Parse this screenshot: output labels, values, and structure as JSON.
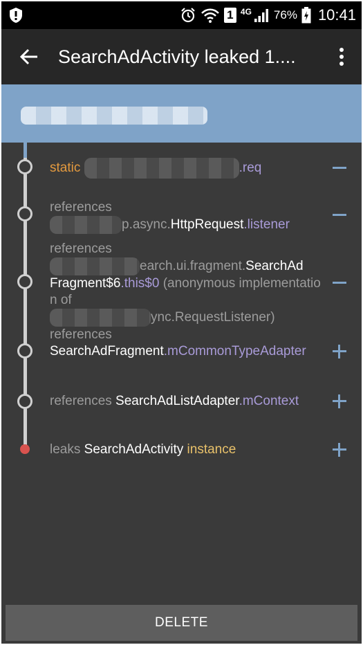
{
  "status_bar": {
    "network": "4G",
    "sim": "1",
    "battery": "76%",
    "time": "10:41",
    "icons": [
      "shield-icon",
      "alarm-icon",
      "wifi-icon",
      "sim-icon",
      "signal-icon",
      "battery-icon"
    ]
  },
  "app_bar": {
    "title": "SearchAdActivity leaked 1....",
    "back_icon": "arrow-back-icon",
    "menu_icon": "overflow-menu-icon"
  },
  "trace": [
    {
      "parts": [
        {
          "t": "static ",
          "c": "orange"
        },
        {
          "t": ".req",
          "c": "purple"
        }
      ],
      "toggle": "minus"
    },
    {
      "parts": [
        {
          "t": "references",
          "c": "grey"
        },
        {
          "t": "p.async.",
          "c": "grey"
        },
        {
          "t": "HttpRequest",
          "c": "white"
        },
        {
          "t": ".listener",
          "c": "purple"
        }
      ],
      "toggle": "minus"
    },
    {
      "parts": [
        {
          "t": "references",
          "c": "grey"
        },
        {
          "t": "earch.ui.fragment.",
          "c": "grey"
        },
        {
          "t": "SearchAd",
          "c": "white"
        },
        {
          "t": "Fragment$6",
          "c": "white"
        },
        {
          "t": ".this$0",
          "c": "purple"
        },
        {
          "t": " (anonymous implementation of",
          "c": "grey"
        },
        {
          "t": "ync.RequestListener)",
          "c": "grey"
        }
      ],
      "toggle": "minus"
    },
    {
      "parts": [
        {
          "t": "references",
          "c": "grey"
        },
        {
          "t": "SearchAdFragment",
          "c": "white"
        },
        {
          "t": ".mCommonTypeAdapter",
          "c": "purple"
        }
      ],
      "toggle": "plus"
    },
    {
      "parts": [
        {
          "t": "references ",
          "c": "grey"
        },
        {
          "t": "SearchAdListAdapter",
          "c": "white"
        },
        {
          "t": ".mContext",
          "c": "purple"
        }
      ],
      "toggle": "plus"
    },
    {
      "parts": [
        {
          "t": "leaks ",
          "c": "grey"
        },
        {
          "t": "SearchAdActivity",
          "c": "white"
        },
        {
          "t": " instance",
          "c": "yellow"
        }
      ],
      "toggle": "plus"
    }
  ],
  "footer": {
    "delete_label": "DELETE"
  },
  "colors": {
    "background": "#3a3a3a",
    "app_bar": "#272727",
    "header_band": "#7fa3c8",
    "accent_orange": "#e49a3f",
    "accent_purple": "#a99bd8",
    "leak_red": "#d9534f"
  }
}
